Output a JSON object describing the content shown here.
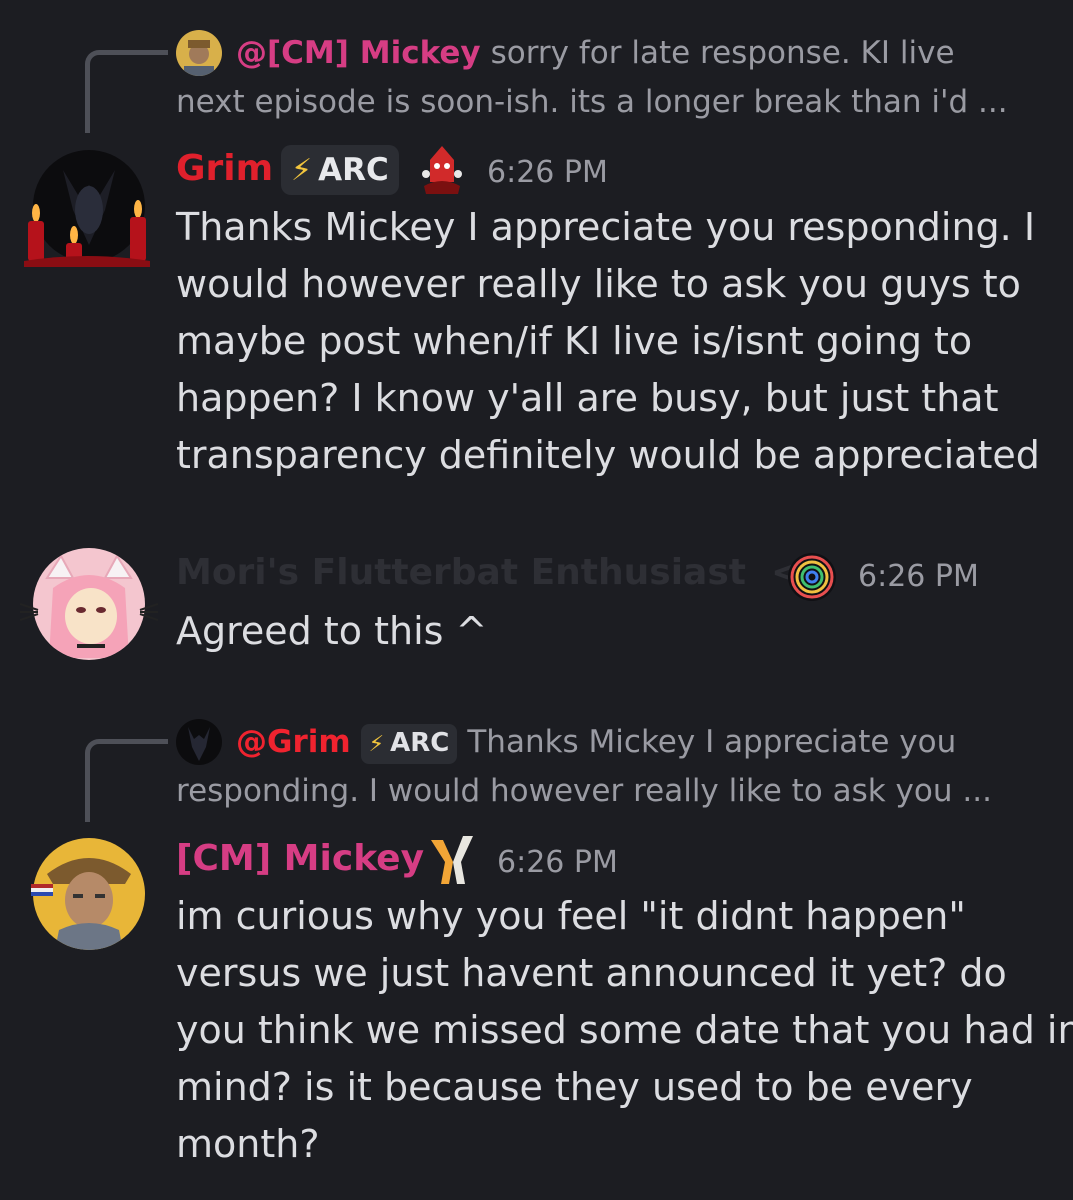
{
  "messages": [
    {
      "reply": {
        "mention": "@[CM] Mickey",
        "lines": [
          "sorry for late response.  KI live",
          "next episode is soon-ish.  its a longer break than i'd ..."
        ]
      },
      "author": "Grim",
      "author_color": "#e0202c",
      "badge": "ARC",
      "time": "6:26 PM",
      "lines": [
        "Thanks Mickey I appreciate you responding. I",
        "would however really like to ask you guys to",
        "maybe post when/if KI live is/isnt going to",
        "happen? I know y'all are busy, but just that",
        "transparency definitely would  be appreciated"
      ]
    },
    {
      "author": "Mori's Flutterbat Enthusiast  <3",
      "author_color": "#2a2b30",
      "time": "6:26 PM",
      "lines": [
        "Agreed to this ^"
      ]
    },
    {
      "reply": {
        "mention": "@Grim",
        "badge": "ARC",
        "lines": [
          "Thanks Mickey I appreciate you",
          "responding. I would however really like to ask you ..."
        ]
      },
      "author": "[CM] Mickey",
      "author_color": "#d63d84",
      "time": "6:26 PM",
      "lines": [
        "im curious why you feel \"it didnt happen\"",
        "versus we just havent announced it yet?  do",
        "you think we missed some date that you had in",
        "mind?  is it because they used to be every",
        "month?"
      ]
    }
  ]
}
